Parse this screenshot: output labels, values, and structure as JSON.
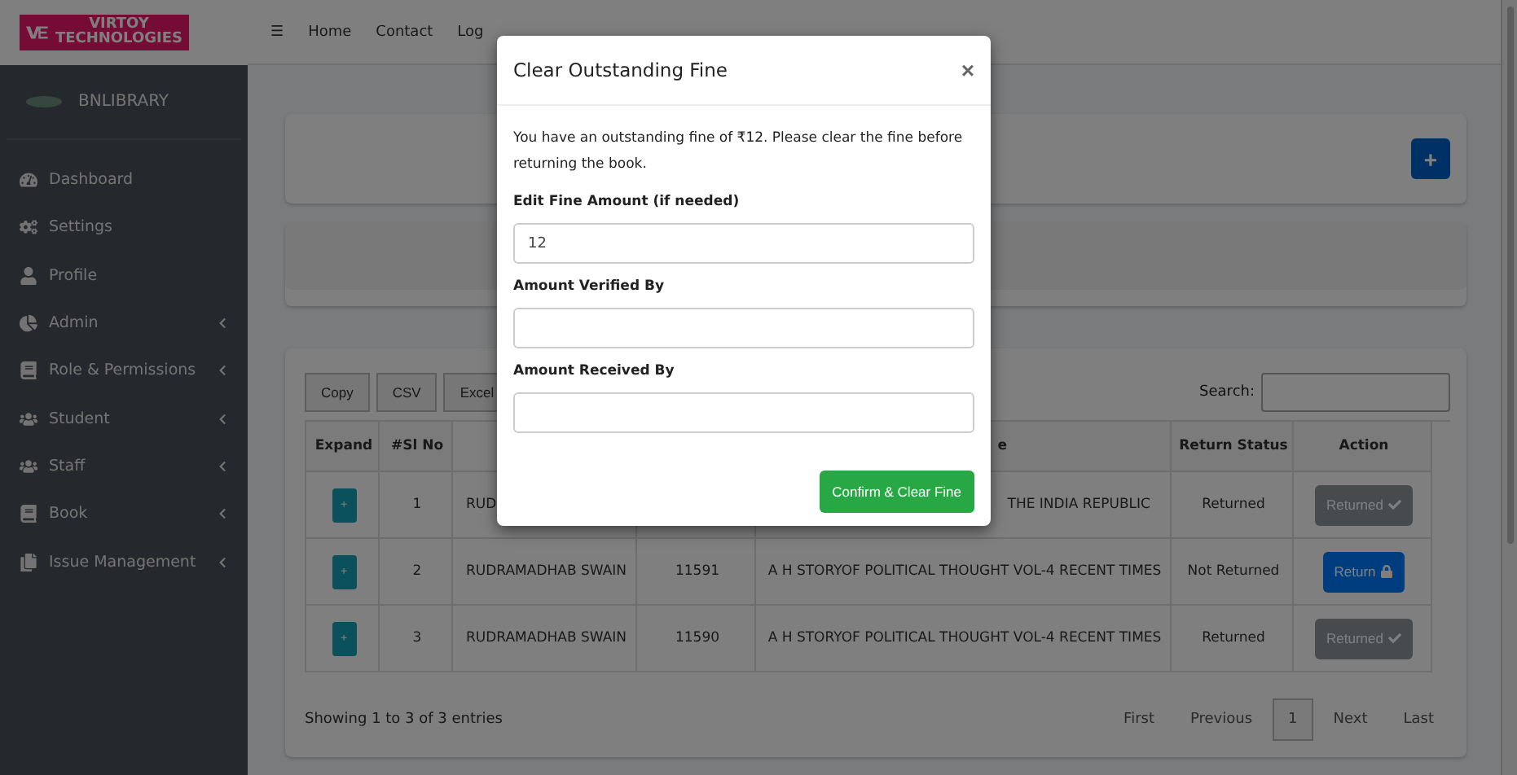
{
  "logo": {
    "line_1": "VIRTOY",
    "line_2": "TECHNOLOGIES"
  },
  "brand": "BNLIBRARY",
  "sidebar": {
    "items": [
      {
        "label": "Dashboard",
        "has_submenu": false
      },
      {
        "label": "Settings",
        "has_submenu": false
      },
      {
        "label": "Profile",
        "has_submenu": false
      },
      {
        "label": "Admin",
        "has_submenu": true
      },
      {
        "label": "Role & Permissions",
        "has_submenu": true
      },
      {
        "label": "Student",
        "has_submenu": true
      },
      {
        "label": "Staff",
        "has_submenu": true
      },
      {
        "label": "Book",
        "has_submenu": true
      },
      {
        "label": "Issue Management",
        "has_submenu": true
      }
    ]
  },
  "topbar": {
    "menu": "☰",
    "links": [
      "Home",
      "Contact",
      "Log"
    ]
  },
  "add_button": "+",
  "table": {
    "buttons": [
      "Copy",
      "CSV",
      "Excel"
    ],
    "search_label": "Search:",
    "columns": [
      {
        "label": "Expand"
      },
      {
        "label": "#Sl No"
      },
      {},
      {},
      {
        "label": "e",
        "cut": true
      },
      {
        "label": "Return Status"
      },
      {
        "label": "Action"
      }
    ],
    "rows": [
      {
        "expand": "+",
        "sl": "1",
        "name": "RUD",
        "title": "THE INDIA REPUBLIC",
        "title_cut": true,
        "status": "Returned",
        "action": {
          "kind": "returned",
          "label": "Returned"
        }
      },
      {
        "expand": "+",
        "sl": "2",
        "name": "RUDRAMADHAB SWAIN",
        "accession": "11591",
        "title": "A H STORYOF POLITICAL THOUGHT VOL-4 RECENT TIMES",
        "title_cut": false,
        "status": "Not Returned",
        "action": {
          "kind": "return",
          "label": "Return"
        }
      },
      {
        "expand": "+",
        "sl": "3",
        "name": "RUDRAMADHAB SWAIN",
        "accession": "11590",
        "title": "A H STORYOF POLITICAL THOUGHT VOL-4 RECENT TIMES",
        "title_cut": false,
        "status": "Returned",
        "action": {
          "kind": "returned",
          "label": "Returned"
        }
      }
    ],
    "info": "Showing 1 to 3 of 3 entries",
    "pagination": [
      {
        "label": "First",
        "selected": false
      },
      {
        "label": "Previous",
        "selected": false
      },
      {
        "label": "1",
        "selected": true
      },
      {
        "label": "Next",
        "selected": false
      },
      {
        "label": "Last",
        "selected": false
      }
    ]
  },
  "modal": {
    "title": "Clear Outstanding Fine",
    "close": "×",
    "message": "You have an outstanding fine of ₹12. Please clear the fine before returning the book.",
    "fields": [
      {
        "label": "Edit Fine Amount (if needed)",
        "value": "12"
      },
      {
        "label": "Amount Verified By"
      },
      {
        "label": "Amount Received By"
      }
    ],
    "confirm": "Confirm & Clear Fine"
  }
}
